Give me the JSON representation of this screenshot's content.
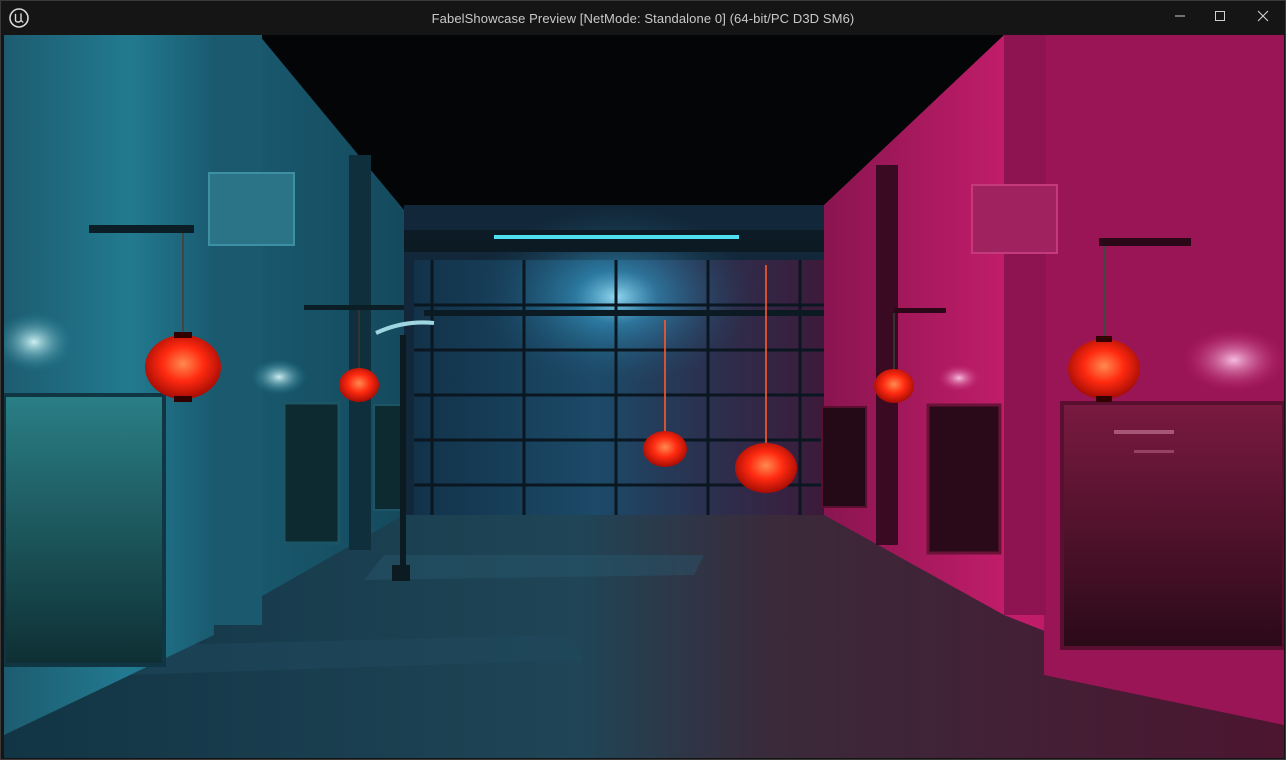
{
  "window": {
    "title": "FabelShowcase Preview [NetMode: Standalone 0]  (64-bit/PC D3D SM6)",
    "app_icon": "unreal-engine-logo-icon",
    "controls": {
      "minimize_icon": "minimize-icon",
      "maximize_icon": "maximize-icon",
      "close_icon": "close-icon"
    }
  },
  "viewport": {
    "description_hidden": "",
    "palette": {
      "left_wall": "#1a6a80",
      "right_wall": "#b0145e",
      "lantern": "#ff3a1a",
      "back_wall": "#1a3d5a",
      "floor_left": "#1a3a4a",
      "floor_right": "#4a1830"
    }
  }
}
